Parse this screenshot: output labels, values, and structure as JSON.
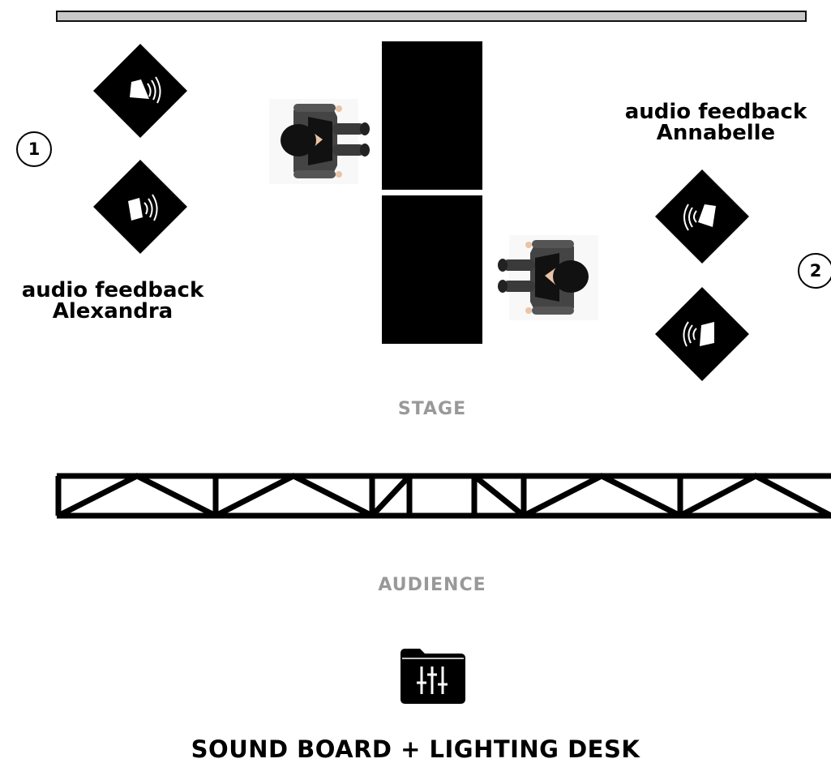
{
  "positions": [
    {
      "number": "1",
      "feedback_title": "audio feedback",
      "performer": "Alexandra"
    },
    {
      "number": "2",
      "feedback_title": "audio feedback",
      "performer": "Annabelle"
    }
  ],
  "zones": {
    "stage": "STAGE",
    "audience": "AUDIENCE"
  },
  "desk": {
    "label": "SOUND BOARD + LIGHTING DESK",
    "icon": "mixer-sliders-icon"
  },
  "icons": {
    "monitor": "floor-wedge-speaker-icon",
    "performer": "performer-top-view-icon",
    "truss": "truss-beam"
  },
  "colors": {
    "ink": "#000000",
    "zone_label": "#999999",
    "top_bar": "#c8c8c8"
  }
}
